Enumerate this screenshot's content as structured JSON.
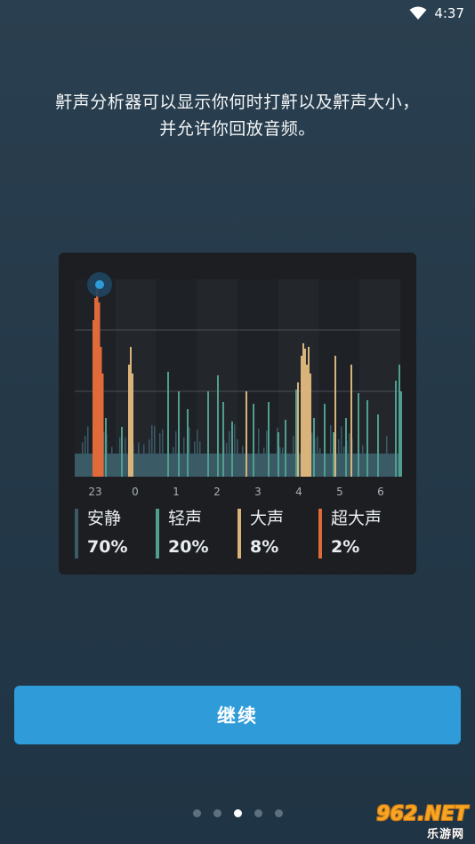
{
  "status_bar": {
    "time": "4:37"
  },
  "intro": {
    "line1": "鼾声分析器可以显示你何时打鼾以及鼾声大小，",
    "line2": "并允许你回放音频。"
  },
  "chart_data": {
    "type": "area",
    "x_tick_labels": [
      "23",
      "0",
      "1",
      "2",
      "3",
      "4",
      "5",
      "6"
    ],
    "categories": [
      {
        "name": "安静",
        "percent": "70%",
        "color": "#3a5a66"
      },
      {
        "name": "轻声",
        "percent": "20%",
        "color": "#4f9e8e"
      },
      {
        "name": "大声",
        "percent": "8%",
        "color": "#d9b37a"
      },
      {
        "name": "超大声",
        "percent": "2%",
        "color": "#e06a3a"
      }
    ],
    "grid": true,
    "peak_marker_color": "#2f9bd8"
  },
  "button": {
    "label": "继续"
  },
  "pager": {
    "count": 5,
    "active_index": 2
  },
  "watermark": {
    "main": "962.NET",
    "sub": "乐游网"
  }
}
